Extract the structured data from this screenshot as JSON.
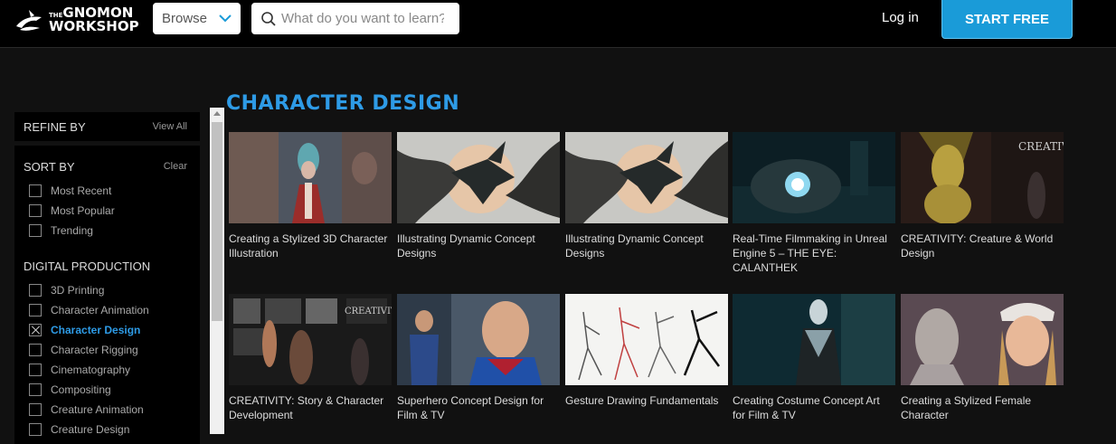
{
  "header": {
    "logo": {
      "the": "THE",
      "line1": "GNOMON",
      "line2": "WORKSHOP"
    },
    "browse_label": "Browse",
    "search_placeholder": "What do you want to learn?",
    "login_label": "Log in",
    "start_label": "START FREE",
    "accent_color": "#1a9bd8"
  },
  "sidebar": {
    "refine_title": "REFINE BY",
    "view_all": "View All",
    "sort": {
      "title": "SORT BY",
      "clear": "Clear",
      "options": [
        "Most Recent",
        "Most Popular",
        "Trending"
      ]
    },
    "category": {
      "title": "DIGITAL PRODUCTION",
      "options": [
        {
          "label": "3D Printing",
          "checked": false
        },
        {
          "label": "Character Animation",
          "checked": false
        },
        {
          "label": "Character Design",
          "checked": true
        },
        {
          "label": "Character Rigging",
          "checked": false
        },
        {
          "label": "Cinematography",
          "checked": false
        },
        {
          "label": "Compositing",
          "checked": false
        },
        {
          "label": "Creature Animation",
          "checked": false
        },
        {
          "label": "Creature Design",
          "checked": false
        }
      ]
    }
  },
  "main": {
    "heading": "CHARACTER DESIGN",
    "courses": [
      {
        "title": "Creating a Stylized 3D Character Illustration",
        "thumb": "stylized-3d"
      },
      {
        "title": "Illustrating Dynamic Concept Designs",
        "thumb": "dragon"
      },
      {
        "title": "Illustrating Dynamic Concept Designs",
        "thumb": "dragon"
      },
      {
        "title": "Real-Time Filmmaking in Unreal Engine 5 – THE EYE: CALANTHEK",
        "thumb": "robot-eye"
      },
      {
        "title": "CREATIVITY: Creature & World Design",
        "thumb": "creature-gold"
      },
      {
        "title": "CREATIVITY: Story & Character Development",
        "thumb": "creativity-collage"
      },
      {
        "title": "Superhero Concept Design for Film & TV",
        "thumb": "superhero"
      },
      {
        "title": "Gesture Drawing Fundamentals",
        "thumb": "gesture-sketch"
      },
      {
        "title": "Creating Costume Concept Art for Film & TV",
        "thumb": "costume"
      },
      {
        "title": "Creating a Stylized Female Character",
        "thumb": "female-char"
      }
    ]
  }
}
